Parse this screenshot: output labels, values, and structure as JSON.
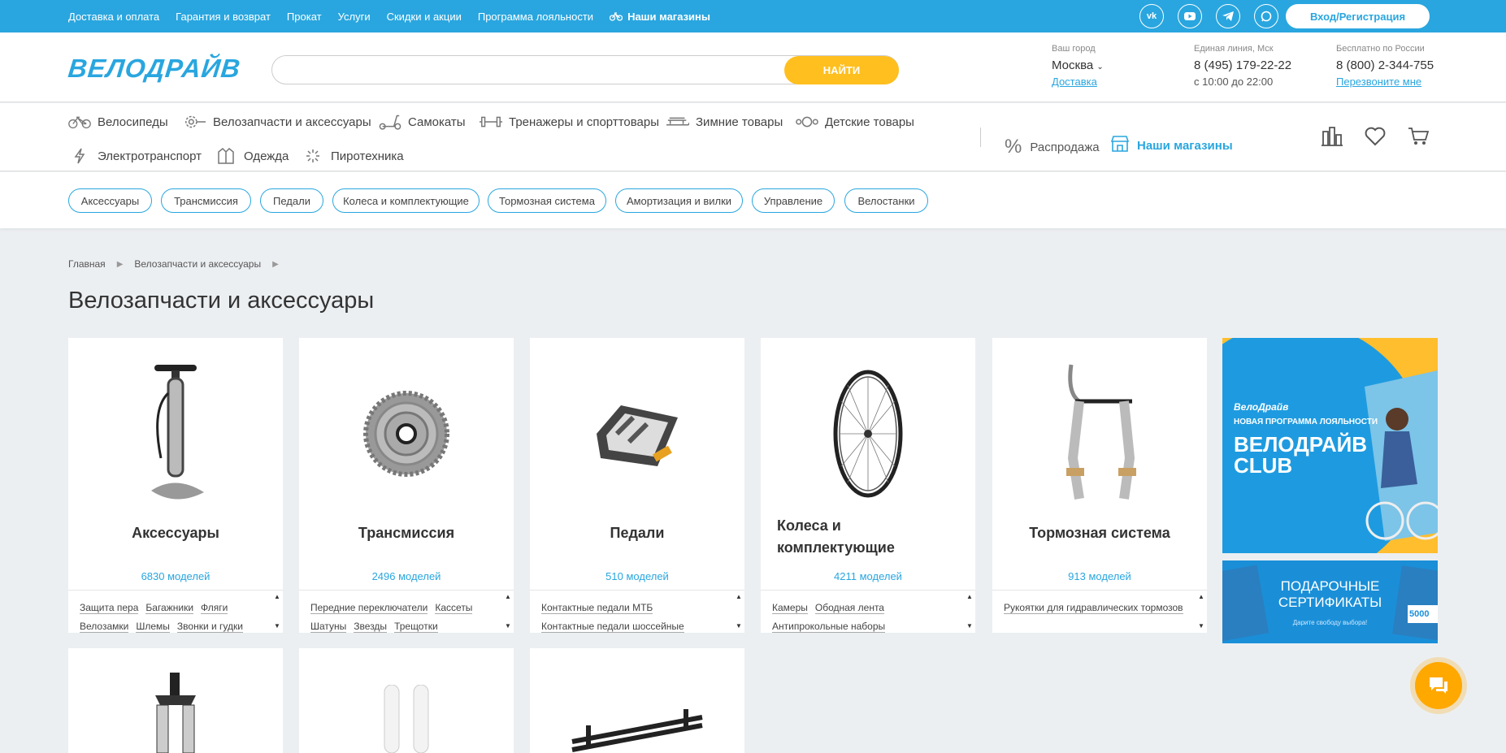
{
  "topbar": {
    "links": [
      "Доставка и оплата",
      "Гарантия и возврат",
      "Прокат",
      "Услуги",
      "Скидки и акции",
      "Программа лояльности"
    ],
    "stores_label": "Наши магазины",
    "social": [
      "vk-icon",
      "youtube-icon",
      "telegram-icon",
      "chat-icon"
    ],
    "login_label": "Вход/Регистрация"
  },
  "header": {
    "logo_text": "ВЕЛОДРАЙВ",
    "search_placeholder": "",
    "search_button": "НАЙТИ",
    "city_caption": "Ваш город",
    "city_value": "Москва",
    "delivery_link": "Доставка",
    "line_caption": "Единая линия, Мск",
    "line_phone": "8 (495) 179-22-22",
    "line_hours": "с 10:00 до 22:00",
    "free_caption": "Бесплатно по России",
    "free_phone": "8 (800) 2-344-755",
    "callback_link": "Перезвоните мне"
  },
  "nav": {
    "categories": [
      "Велосипеды",
      "Велозапчасти и аксессуары",
      "Самокаты",
      "Тренажеры и спорттовары",
      "Зимние товары",
      "Детские товары",
      "Электротранспорт",
      "Одежда",
      "Пиротехника"
    ],
    "sale_label": "Распродажа",
    "stores_label": "Наши магазины"
  },
  "chips": [
    "Аксессуары",
    "Трансмиссия",
    "Педали",
    "Колеса и комплектующие",
    "Тормозная система",
    "Амортизация и вилки",
    "Управление",
    "Велостанки"
  ],
  "breadcrumb": [
    "Главная",
    "Велозапчасти и аксессуары"
  ],
  "page_title": "Велозапчасти и аксессуары",
  "cards": [
    {
      "title": "Аксессуары",
      "count": "6830 моделей",
      "subs": [
        "Защита пера",
        "Багажники",
        "Фляги",
        "Велозамки",
        "Шлемы",
        "Звонки и гудки"
      ]
    },
    {
      "title": "Трансмиссия",
      "count": "2496 моделей",
      "subs": [
        "Передние переключатели",
        "Кассеты",
        "Шатуны",
        "Звезды",
        "Трещотки"
      ]
    },
    {
      "title": "Педали",
      "count": "510 моделей",
      "subs": [
        "Контактные педали МТБ",
        "Контактные педали шоссейные"
      ]
    },
    {
      "title": "Колеса и комплектующие",
      "count": "4211 моделей",
      "subs": [
        "Камеры",
        "Ободная лента",
        "Антипрокольные наборы"
      ]
    },
    {
      "title": "Тормозная система",
      "count": "913 моделей",
      "subs": [
        "Рукоятки для гидравлических тормозов"
      ]
    }
  ],
  "banner1": {
    "brand": "ВелоДрайв",
    "tagline": "НОВАЯ ПРОГРАММА ЛОЯЛЬНОСТИ",
    "title1": "ВЕЛОДРАЙВ",
    "title2": "CLUB"
  },
  "banner2": {
    "title1": "ПОДАРОЧНЫЕ",
    "title2": "СЕРТИФИКАТЫ",
    "tagline": "Дарите свободу выбора!",
    "price": "5000"
  }
}
